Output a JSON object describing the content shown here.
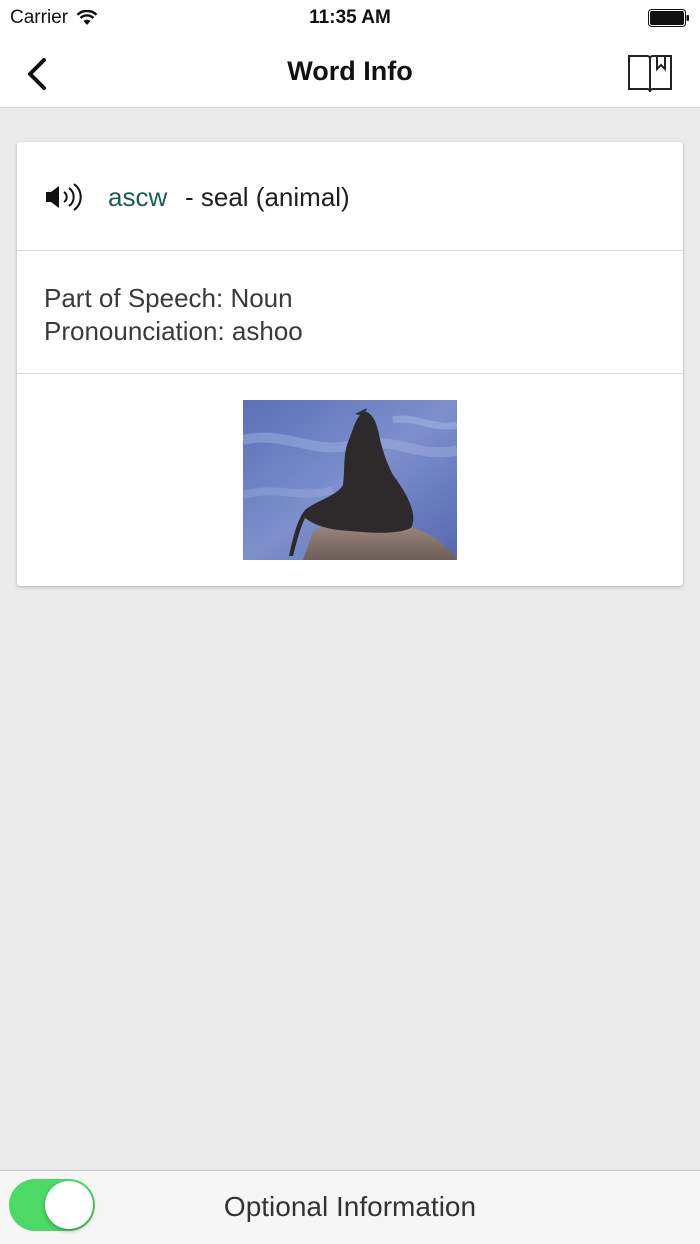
{
  "status_bar": {
    "carrier": "Carrier",
    "time": "11:35 AM"
  },
  "nav": {
    "title": "Word Info",
    "back_icon": "chevron-left-icon",
    "right_icon": "book-bookmark-icon"
  },
  "card": {
    "word": "ascw",
    "definition": "- seal (animal)",
    "part_of_speech": "Part of Speech: Noun",
    "pronunciation": "Pronounciation: ashoo",
    "speaker_icon": "speaker-icon",
    "image_subject": "seal on rock"
  },
  "bottom_bar": {
    "label": "Optional Information",
    "toggle_on": true
  },
  "colors": {
    "word_color": "#1a5c56",
    "toggle_on": "#4cd964",
    "background": "#ebebeb"
  }
}
